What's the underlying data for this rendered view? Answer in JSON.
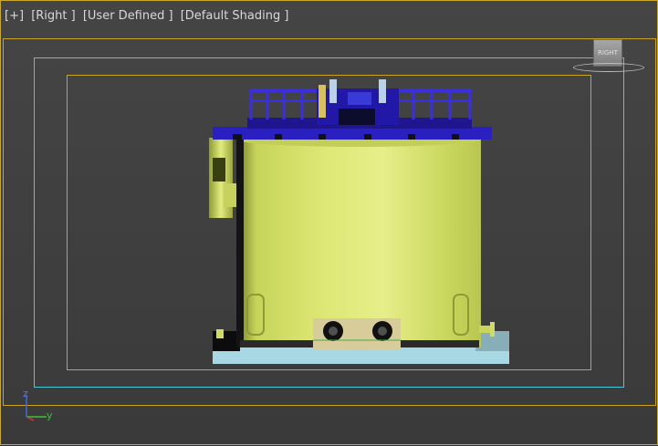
{
  "viewport": {
    "labels": [
      "[+]",
      "[Right ]",
      "[User Defined ]",
      "[Default Shading ]"
    ]
  },
  "viewcube": {
    "face_label": "RIGHT"
  },
  "axis": {
    "z": "z",
    "y": "y"
  },
  "colors": {
    "frame_gold": "#c8a420",
    "frame_cyan": "#48c8d8",
    "tank_body": "#d4e06a",
    "railing_blue": "#2a1fc0",
    "base_slab": "#a8d8e4"
  }
}
